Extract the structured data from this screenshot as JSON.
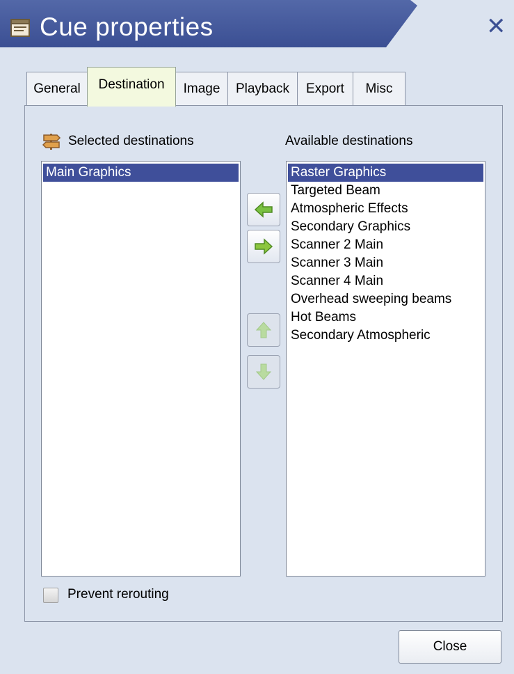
{
  "window": {
    "title": "Cue properties",
    "close_glyph": "✕",
    "title_icon": "properties-window-icon"
  },
  "tabs": [
    {
      "label": "General",
      "active": false
    },
    {
      "label": "Destination",
      "active": true
    },
    {
      "label": "Image",
      "active": false
    },
    {
      "label": "Playback",
      "active": false
    },
    {
      "label": "Export",
      "active": false
    },
    {
      "label": "Misc",
      "active": false
    }
  ],
  "selected": {
    "label": "Selected destinations",
    "icon": "signpost-icon",
    "items": [
      {
        "text": "Main Graphics",
        "selected": true
      }
    ]
  },
  "available": {
    "label": "Available destinations",
    "items": [
      {
        "text": "Raster Graphics",
        "selected": true
      },
      {
        "text": "Targeted Beam",
        "selected": false
      },
      {
        "text": "Atmospheric Effects",
        "selected": false
      },
      {
        "text": "Secondary Graphics",
        "selected": false
      },
      {
        "text": "Scanner 2 Main",
        "selected": false
      },
      {
        "text": "Scanner 3 Main",
        "selected": false
      },
      {
        "text": "Scanner 4 Main",
        "selected": false
      },
      {
        "text": "Overhead sweeping beams",
        "selected": false
      },
      {
        "text": "Hot Beams",
        "selected": false
      },
      {
        "text": "Secondary Atmospheric",
        "selected": false
      }
    ]
  },
  "buttons": {
    "add": {
      "icon": "arrow-left-icon",
      "enabled": true
    },
    "remove": {
      "icon": "arrow-right-icon",
      "enabled": true
    },
    "move_up": {
      "icon": "arrow-up-icon",
      "enabled": false
    },
    "move_down": {
      "icon": "arrow-down-icon",
      "enabled": false
    },
    "close_label": "Close"
  },
  "prevent_rerouting": {
    "label": "Prevent rerouting",
    "checked": false
  },
  "colors": {
    "titlebar": "#3b4f93",
    "selection": "#3f4f9a",
    "active_tab": "#f3f9df",
    "arrow_green": "#7ac142"
  }
}
